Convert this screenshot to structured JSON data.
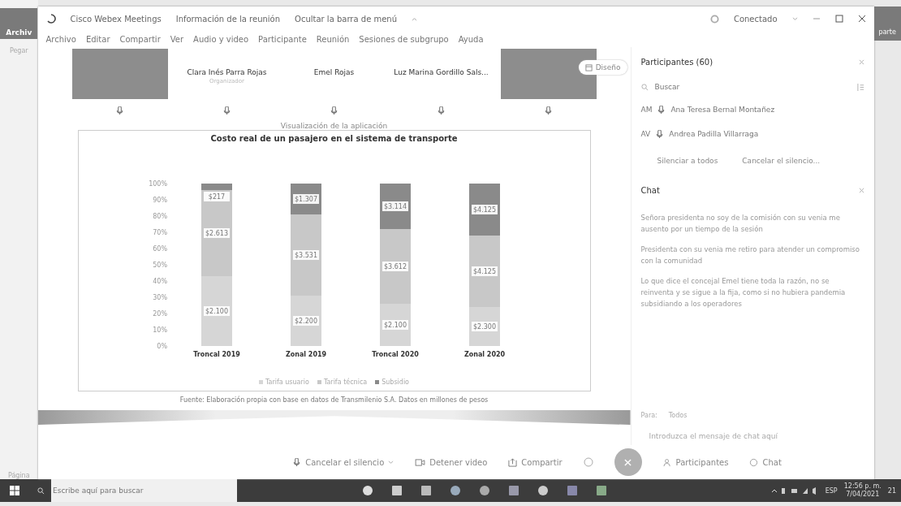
{
  "background_app": {
    "tab": "Archiv",
    "paste": "Pegar",
    "status": "Página",
    "right_label": "parte"
  },
  "window": {
    "title": "Cisco Webex Meetings",
    "info": "Información de la reunión",
    "hide_menu": "Ocultar la barra de menú",
    "status": "Conectado"
  },
  "menu": [
    "Archivo",
    "Editar",
    "Compartir",
    "Ver",
    "Audio y video",
    "Participante",
    "Reunión",
    "Sesiones de subgrupo",
    "Ayuda"
  ],
  "video_strip": [
    {
      "kind": "video"
    },
    {
      "kind": "name",
      "name": "Clara Inés Parra Rojas",
      "role": "Organizador"
    },
    {
      "kind": "name",
      "name": "Emel Rojas"
    },
    {
      "kind": "name",
      "name": "Luz Marina Gordillo Sals..."
    },
    {
      "kind": "video",
      "layout_button": "Diseño"
    }
  ],
  "shared_content": {
    "label": "Visualización de la aplicación",
    "footnote": "Fuente: Elaboración propia con base en datos de Transmilenio S.A. Datos en millones de pesos",
    "chart_data": {
      "type": "bar",
      "title": "Costo real de un pasajero en el sistema de transporte",
      "stacked": true,
      "categories": [
        "Troncal 2019",
        "Zonal 2019",
        "Troncal 2020",
        "Zonal 2020"
      ],
      "series": [
        {
          "name": "Tarifa usuario",
          "color": "#d6d6d6",
          "values": [
            43,
            31,
            26,
            24
          ]
        },
        {
          "name": "Tarifa técnica",
          "color": "#c8c8c8",
          "values": [
            53,
            50,
            46,
            44
          ]
        },
        {
          "name": "Subsidio",
          "color": "#8a8a8a",
          "values": [
            4,
            19,
            28,
            32
          ]
        }
      ],
      "value_labels": [
        [
          "$2.100",
          "$2.200",
          "$2.100",
          "$2.300"
        ],
        [
          "$2.613",
          "$3.531",
          "$3.612",
          "$4.125"
        ],
        [
          "$217",
          "$1.307",
          "$3.114",
          "$4.125"
        ]
      ],
      "ylim": [
        0,
        100
      ],
      "yticks": [
        {
          "value": 0,
          "label": "0%"
        },
        {
          "value": 10,
          "label": "10%"
        },
        {
          "value": 20,
          "label": "20%"
        },
        {
          "value": 30,
          "label": "30%"
        },
        {
          "value": 40,
          "label": "40%"
        },
        {
          "value": 50,
          "label": "50%"
        },
        {
          "value": 60,
          "label": "60%"
        },
        {
          "value": 70,
          "label": "70%"
        },
        {
          "value": 80,
          "label": "80%"
        },
        {
          "value": 90,
          "label": "90%"
        },
        {
          "value": 100,
          "label": "100%"
        }
      ]
    }
  },
  "controls": [
    {
      "kind": "mic",
      "label": "Cancelar el silencio"
    },
    {
      "kind": "video",
      "label": "Detener video"
    },
    {
      "kind": "share",
      "label": "Compartir"
    },
    {
      "kind": "more"
    },
    {
      "kind": "end"
    },
    {
      "kind": "participants",
      "label": "Participantes"
    },
    {
      "kind": "chat",
      "label": "Chat"
    }
  ],
  "participants_panel": {
    "title": "Participantes (60)",
    "search": {
      "placeholder": "Buscar"
    },
    "items": [
      {
        "initials": "AM",
        "name": "Ana Teresa Bernal Montañez"
      },
      {
        "initials": "AV",
        "name": "Andrea Padilla Villarraga"
      }
    ],
    "buttons": [
      "Silenciar a todos",
      "Cancelar el silencio..."
    ]
  },
  "chat_panel": {
    "title": "Chat",
    "messages": [
      "Señora presidenta no soy de la comisión con su venia me ausento por un tiempo de la sesión",
      "Presidenta con su venia me retiro para atender un compromiso con la comunidad",
      "Lo que dice el concejal Emel tiene toda la razón, no se reinventa y se sigue a la fija, como si no hubiera pandemia subsidiando a los operadores"
    ],
    "to_label": "Para:",
    "to_value": "Todos",
    "input": {
      "placeholder": "Introduzca el mensaje de chat aquí"
    }
  },
  "taskbar": {
    "search": {
      "placeholder": "Escribe aquí para buscar"
    },
    "language": "ESP",
    "time": "12:56 p. m.",
    "date": "7/04/2021",
    "notifications": "21"
  }
}
